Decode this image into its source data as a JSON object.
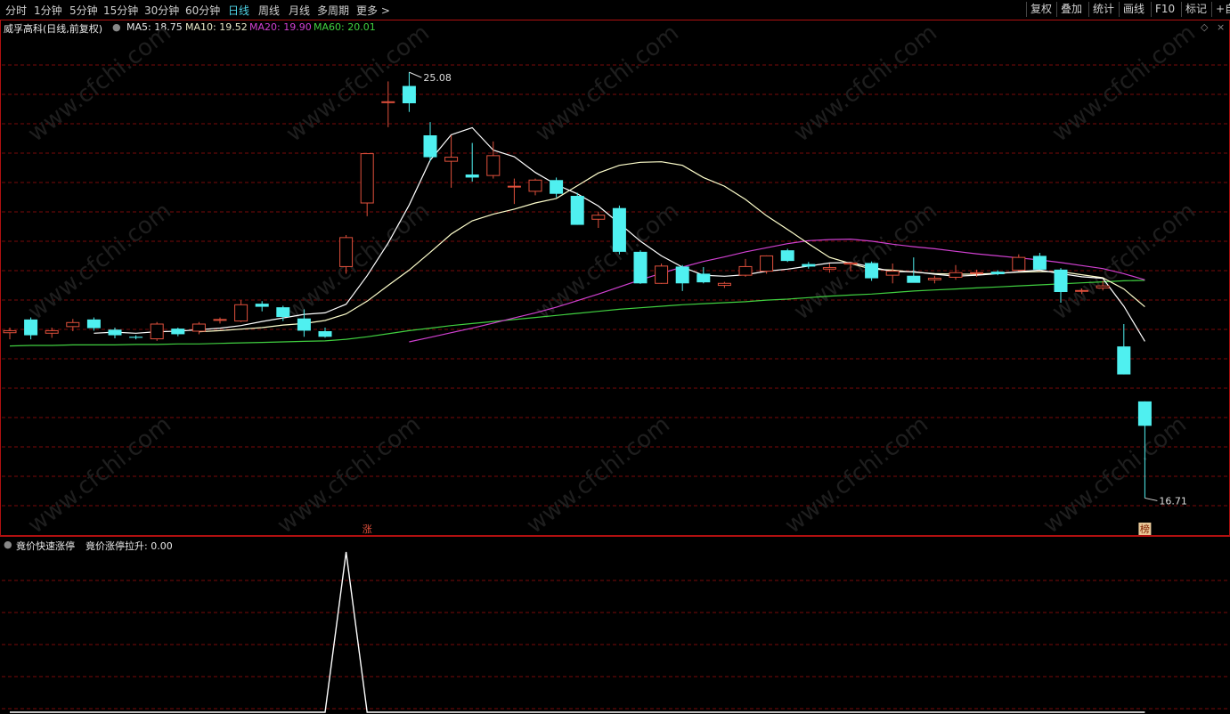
{
  "toolbar": {
    "tabs": [
      {
        "label": "分时",
        "active": false
      },
      {
        "label": "1分钟",
        "active": false
      },
      {
        "label": "5分钟",
        "active": false
      },
      {
        "label": "15分钟",
        "active": false
      },
      {
        "label": "30分钟",
        "active": false
      },
      {
        "label": "60分钟",
        "active": false
      },
      {
        "label": "日线",
        "active": true
      },
      {
        "label": "周线",
        "active": false
      },
      {
        "label": "月线",
        "active": false
      },
      {
        "label": "多周期",
        "active": false
      },
      {
        "label": "更多 >",
        "active": false
      }
    ],
    "right_buttons": [
      "复权",
      "叠加",
      "统计",
      "画线",
      "F10",
      "标记",
      "+自"
    ]
  },
  "info": {
    "title": "威孚高科(日线,前复权)",
    "ma5": "MA5: 18.75",
    "ma10": "MA10: 19.52",
    "ma20": "MA20: 19.90",
    "ma60": "MA60: 20.01"
  },
  "indicator": {
    "name": "竟价快速涨停",
    "value_text": "竟价涨停拉升: 0.00"
  },
  "colors": {
    "up": "#e0503c",
    "down": "#4ff0f0",
    "ma5": "#ffffff",
    "ma10": "#ffffcc",
    "ma20": "#d040d0",
    "ma60": "#40d040",
    "grid": "#7a0a0a",
    "border": "#b01010",
    "active_tab": "#4fd3e6"
  },
  "chart_data": {
    "type": "candlestick",
    "high_label": "25.08",
    "low_label": "16.71",
    "markers": [
      {
        "label": "涨",
        "candle": 17
      },
      {
        "label": "榜",
        "candle": 54
      }
    ],
    "ylim": [
      16.0,
      25.8
    ],
    "candles": [
      {
        "o": 19.96,
        "h": 20.06,
        "l": 19.83,
        "c": 20.0
      },
      {
        "o": 20.22,
        "h": 20.26,
        "l": 19.83,
        "c": 19.91
      },
      {
        "o": 19.95,
        "h": 20.06,
        "l": 19.86,
        "c": 20.0
      },
      {
        "o": 20.08,
        "h": 20.23,
        "l": 19.99,
        "c": 20.16
      },
      {
        "o": 20.22,
        "h": 20.26,
        "l": 20.0,
        "c": 20.05
      },
      {
        "o": 20.02,
        "h": 20.06,
        "l": 19.85,
        "c": 19.91
      },
      {
        "o": 19.88,
        "h": 19.91,
        "l": 19.83,
        "c": 19.86
      },
      {
        "o": 19.84,
        "h": 20.17,
        "l": 19.8,
        "c": 20.13
      },
      {
        "o": 20.04,
        "h": 20.06,
        "l": 19.89,
        "c": 19.93
      },
      {
        "o": 19.99,
        "h": 20.17,
        "l": 19.93,
        "c": 20.13
      },
      {
        "o": 20.22,
        "h": 20.26,
        "l": 20.14,
        "c": 20.22
      },
      {
        "o": 20.19,
        "h": 20.6,
        "l": 20.17,
        "c": 20.51
      },
      {
        "o": 20.53,
        "h": 20.58,
        "l": 20.38,
        "c": 20.47
      },
      {
        "o": 20.46,
        "h": 20.49,
        "l": 20.19,
        "c": 20.27
      },
      {
        "o": 20.24,
        "h": 20.42,
        "l": 19.88,
        "c": 20.0
      },
      {
        "o": 19.99,
        "h": 20.06,
        "l": 19.86,
        "c": 19.88
      },
      {
        "o": 21.26,
        "h": 21.88,
        "l": 21.12,
        "c": 21.83
      },
      {
        "o": 22.51,
        "h": 23.48,
        "l": 22.25,
        "c": 23.48
      },
      {
        "o": 24.5,
        "h": 24.9,
        "l": 24.0,
        "c": 24.5
      },
      {
        "o": 24.81,
        "h": 25.08,
        "l": 24.3,
        "c": 24.47
      },
      {
        "o": 23.84,
        "h": 24.1,
        "l": 23.33,
        "c": 23.41
      },
      {
        "o": 23.33,
        "h": 23.84,
        "l": 22.81,
        "c": 23.41
      },
      {
        "o": 23.07,
        "h": 23.69,
        "l": 22.93,
        "c": 23.01
      },
      {
        "o": 23.05,
        "h": 23.72,
        "l": 22.99,
        "c": 23.44
      },
      {
        "o": 22.84,
        "h": 22.99,
        "l": 22.49,
        "c": 22.84
      },
      {
        "o": 22.74,
        "h": 22.99,
        "l": 22.66,
        "c": 22.96
      },
      {
        "o": 22.96,
        "h": 23.01,
        "l": 22.62,
        "c": 22.69
      },
      {
        "o": 22.65,
        "h": 22.71,
        "l": 22.08,
        "c": 22.08
      },
      {
        "o": 22.19,
        "h": 22.34,
        "l": 22.02,
        "c": 22.27
      },
      {
        "o": 22.41,
        "h": 22.46,
        "l": 21.5,
        "c": 21.55
      },
      {
        "o": 21.55,
        "h": 21.58,
        "l": 20.92,
        "c": 20.93
      },
      {
        "o": 20.93,
        "h": 21.32,
        "l": 20.92,
        "c": 21.27
      },
      {
        "o": 21.26,
        "h": 21.29,
        "l": 20.78,
        "c": 20.93
      },
      {
        "o": 21.12,
        "h": 21.25,
        "l": 20.93,
        "c": 20.95
      },
      {
        "o": 20.89,
        "h": 20.96,
        "l": 20.84,
        "c": 20.93
      },
      {
        "o": 21.09,
        "h": 21.41,
        "l": 21.06,
        "c": 21.26
      },
      {
        "o": 21.17,
        "h": 21.48,
        "l": 21.12,
        "c": 21.47
      },
      {
        "o": 21.58,
        "h": 21.61,
        "l": 21.35,
        "c": 21.37
      },
      {
        "o": 21.31,
        "h": 21.35,
        "l": 21.22,
        "c": 21.26
      },
      {
        "o": 21.21,
        "h": 21.32,
        "l": 21.14,
        "c": 21.24
      },
      {
        "o": 21.31,
        "h": 21.34,
        "l": 21.17,
        "c": 21.33
      },
      {
        "o": 21.33,
        "h": 21.36,
        "l": 20.98,
        "c": 21.03
      },
      {
        "o": 21.09,
        "h": 21.32,
        "l": 20.93,
        "c": 21.17
      },
      {
        "o": 21.08,
        "h": 21.44,
        "l": 21.03,
        "c": 20.94
      },
      {
        "o": 21.0,
        "h": 21.08,
        "l": 20.93,
        "c": 21.03
      },
      {
        "o": 21.05,
        "h": 21.29,
        "l": 21.0,
        "c": 21.14
      },
      {
        "o": 21.14,
        "h": 21.2,
        "l": 21.06,
        "c": 21.14
      },
      {
        "o": 21.16,
        "h": 21.19,
        "l": 21.09,
        "c": 21.11
      },
      {
        "o": 21.19,
        "h": 21.5,
        "l": 21.17,
        "c": 21.44
      },
      {
        "o": 21.47,
        "h": 21.53,
        "l": 21.2,
        "c": 21.2
      },
      {
        "o": 21.2,
        "h": 21.23,
        "l": 20.55,
        "c": 20.76
      },
      {
        "o": 20.78,
        "h": 20.83,
        "l": 20.72,
        "c": 20.79
      },
      {
        "o": 20.84,
        "h": 20.98,
        "l": 20.79,
        "c": 20.88
      },
      {
        "o": 19.69,
        "h": 20.13,
        "l": 19.14,
        "c": 19.14
      },
      {
        "o": 18.61,
        "h": 18.61,
        "l": 16.71,
        "c": 18.13
      }
    ],
    "ma5": [
      null,
      null,
      null,
      null,
      19.95,
      19.97,
      19.95,
      19.98,
      19.99,
      20.02,
      20.05,
      20.1,
      20.18,
      20.25,
      20.32,
      20.35,
      20.52,
      21.08,
      21.72,
      22.47,
      23.35,
      23.85,
      23.99,
      23.55,
      23.42,
      23.11,
      22.87,
      22.69,
      22.45,
      22.11,
      21.76,
      21.47,
      21.25,
      21.09,
      21.07,
      21.1,
      21.17,
      21.21,
      21.27,
      21.33,
      21.34,
      21.25,
      21.16,
      21.16,
      21.11,
      21.07,
      21.09,
      21.12,
      21.16,
      21.19,
      21.12,
      21.06,
      21.03,
      20.48,
      19.79
    ],
    "ma10": [
      null,
      null,
      null,
      null,
      null,
      null,
      null,
      null,
      null,
      19.98,
      20.0,
      20.03,
      20.06,
      20.11,
      20.14,
      20.2,
      20.33,
      20.58,
      20.89,
      21.19,
      21.54,
      21.9,
      22.16,
      22.29,
      22.39,
      22.51,
      22.6,
      22.85,
      23.1,
      23.25,
      23.31,
      23.32,
      23.25,
      23.01,
      22.84,
      22.58,
      22.26,
      21.99,
      21.71,
      21.44,
      21.32,
      21.21,
      21.19,
      21.15,
      21.12,
      21.11,
      21.11,
      21.13,
      21.15,
      21.16,
      21.16,
      21.1,
      21.04,
      20.82,
      20.47
    ],
    "ma20": [
      null,
      null,
      null,
      null,
      null,
      null,
      null,
      null,
      null,
      null,
      null,
      null,
      null,
      null,
      null,
      null,
      null,
      null,
      null,
      19.78,
      19.87,
      19.96,
      20.05,
      20.15,
      20.25,
      20.35,
      20.46,
      20.59,
      20.72,
      20.86,
      21.0,
      21.13,
      21.25,
      21.36,
      21.45,
      21.55,
      21.63,
      21.71,
      21.77,
      21.79,
      21.8,
      21.76,
      21.7,
      21.65,
      21.61,
      21.56,
      21.51,
      21.47,
      21.43,
      21.39,
      21.34,
      21.28,
      21.22,
      21.12,
      21.0
    ],
    "ma60": [
      19.7,
      19.71,
      19.71,
      19.72,
      19.72,
      19.72,
      19.73,
      19.73,
      19.74,
      19.74,
      19.75,
      19.76,
      19.77,
      19.78,
      19.79,
      19.8,
      19.83,
      19.88,
      19.94,
      20.0,
      20.05,
      20.1,
      20.14,
      20.18,
      20.22,
      20.26,
      20.3,
      20.34,
      20.38,
      20.42,
      20.45,
      20.48,
      20.51,
      20.53,
      20.55,
      20.57,
      20.6,
      20.62,
      20.65,
      20.68,
      20.7,
      20.72,
      20.75,
      20.78,
      20.8,
      20.82,
      20.84,
      20.86,
      20.88,
      20.9,
      20.92,
      20.94,
      20.96,
      20.98,
      20.99
    ],
    "indicator_values": [
      0,
      0,
      0,
      0,
      0,
      0,
      0,
      0,
      0,
      0,
      0,
      0,
      0,
      0,
      0,
      0,
      1,
      0,
      0,
      0,
      0,
      0,
      0,
      0,
      0,
      0,
      0,
      0,
      0,
      0,
      0,
      0,
      0,
      0,
      0,
      0,
      0,
      0,
      0,
      0,
      0,
      0,
      0,
      0,
      0,
      0,
      0,
      0,
      0,
      0,
      0,
      0,
      0,
      0,
      0
    ]
  }
}
